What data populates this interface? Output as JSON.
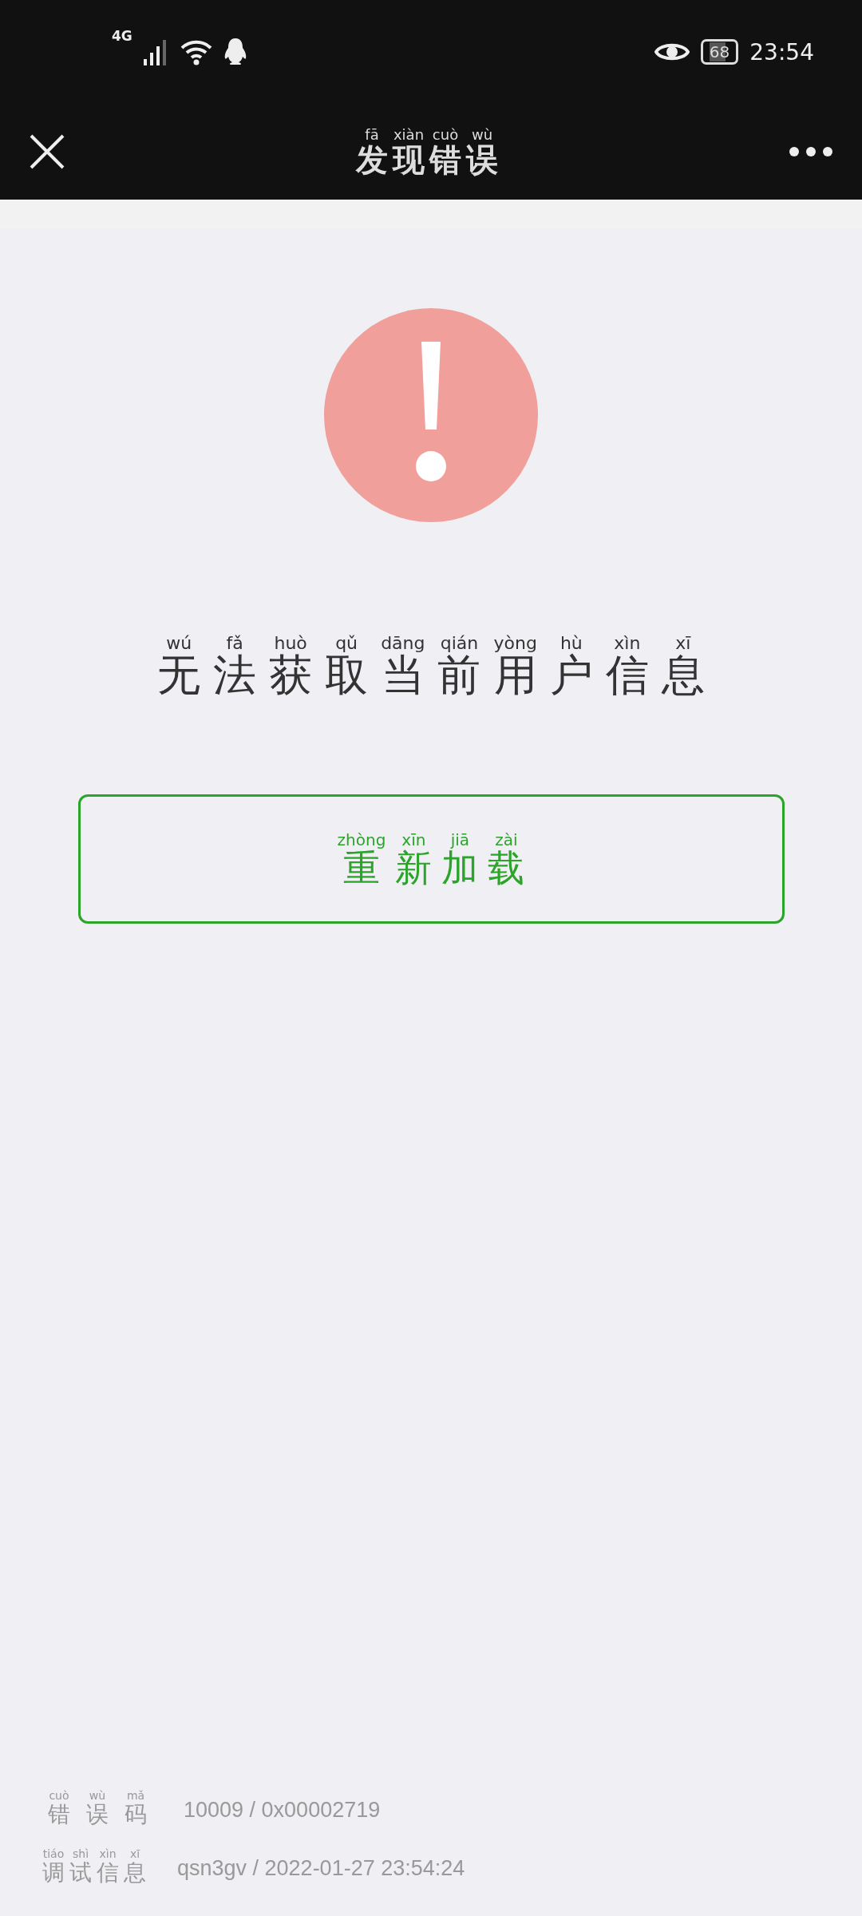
{
  "status_bar": {
    "network": "4G",
    "battery": "68",
    "time": "23:54"
  },
  "header": {
    "title": [
      {
        "hanzi": "发",
        "pinyin": "fā"
      },
      {
        "hanzi": "现",
        "pinyin": "xiàn"
      },
      {
        "hanzi": "错",
        "pinyin": "cuò"
      },
      {
        "hanzi": "误",
        "pinyin": "wù"
      }
    ]
  },
  "error": {
    "message": [
      {
        "hanzi": "无",
        "pinyin": "wú"
      },
      {
        "hanzi": "法",
        "pinyin": "fǎ"
      },
      {
        "hanzi": "获",
        "pinyin": "huò"
      },
      {
        "hanzi": "取",
        "pinyin": "qǔ"
      },
      {
        "hanzi": "当",
        "pinyin": "dāng"
      },
      {
        "hanzi": "前",
        "pinyin": "qián"
      },
      {
        "hanzi": "用",
        "pinyin": "yòng"
      },
      {
        "hanzi": "户",
        "pinyin": "hù"
      },
      {
        "hanzi": "信",
        "pinyin": "xìn"
      },
      {
        "hanzi": "息",
        "pinyin": "xī"
      }
    ]
  },
  "reload_button": {
    "label": [
      {
        "hanzi": "重",
        "pinyin": "zhòng"
      },
      {
        "hanzi": "新",
        "pinyin": "xīn"
      },
      {
        "hanzi": "加",
        "pinyin": "jiā"
      },
      {
        "hanzi": "载",
        "pinyin": "zài"
      }
    ]
  },
  "details": [
    {
      "label": [
        {
          "hanzi": "错",
          "pinyin": "cuò"
        },
        {
          "hanzi": "误",
          "pinyin": "wù"
        },
        {
          "hanzi": "码",
          "pinyin": "mǎ"
        }
      ],
      "value": "10009 / 0x00002719"
    },
    {
      "label": [
        {
          "hanzi": "调",
          "pinyin": "tiáo"
        },
        {
          "hanzi": "试",
          "pinyin": "shì"
        },
        {
          "hanzi": "信",
          "pinyin": "xìn"
        },
        {
          "hanzi": "息",
          "pinyin": "xī"
        }
      ],
      "value": "qsn3gv / 2022-01-27 23:54:24"
    }
  ]
}
